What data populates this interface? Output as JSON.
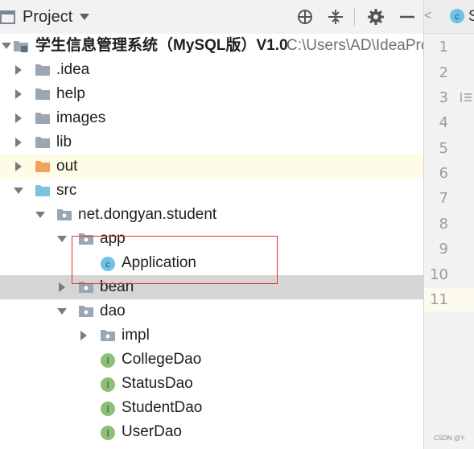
{
  "toolbar": {
    "title": "Project",
    "icons": [
      "window-icon",
      "chevron-down-icon",
      "locate-icon",
      "collapse-all-icon",
      "gear-icon",
      "minimize-icon"
    ]
  },
  "tree": {
    "root": {
      "label": "学生信息管理系统（MySQL版）V1.0",
      "path": "C:\\Users\\AD\\IdeaProj"
    },
    "idea": ".idea",
    "help": "help",
    "images": "images",
    "lib": "lib",
    "out": "out",
    "src": "src",
    "package": "net.dongyan.student",
    "app": "app",
    "application": "Application",
    "bean": "bean",
    "dao": "dao",
    "impl": "impl",
    "college_dao": "CollegeDao",
    "status_dao": "StatusDao",
    "student_dao": "StudentDao",
    "user_dao": "UserDao"
  },
  "editor": {
    "tab_overflow": "<",
    "tab_name": "S",
    "line_numbers": [
      "1",
      "2",
      "3",
      "4",
      "5",
      "6",
      "7",
      "8",
      "9",
      "10",
      "11"
    ],
    "current_line": "11"
  },
  "colors": {
    "folder_gray": "#9aa6b2",
    "folder_out": "#f0a35e",
    "folder_src": "#79c3e0",
    "class_icon": "#6fc2e3",
    "interface_icon": "#8cc079",
    "annotation": "#e03030"
  },
  "watermark": "CSDN @Y."
}
